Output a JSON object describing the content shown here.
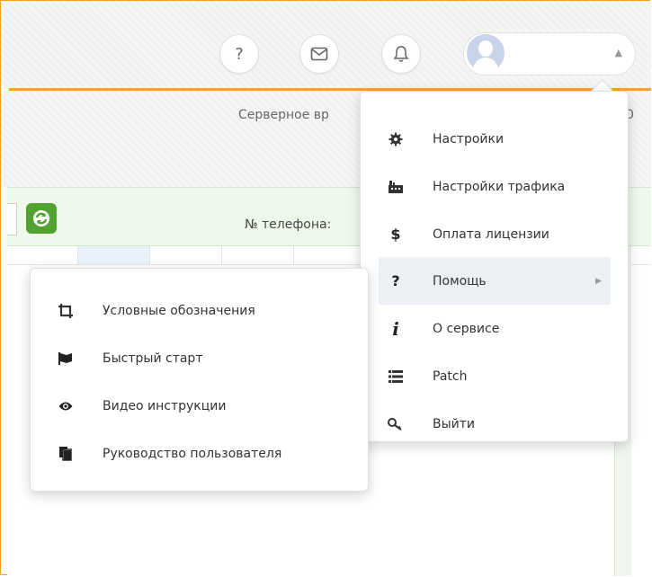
{
  "header": {
    "help_label": "?",
    "user_name": "",
    "user_menu_arrow": "▲"
  },
  "server": {
    "time_label": "Серверное вр",
    "time_tail": "0"
  },
  "filter": {
    "phone_label": "№ телефона:"
  },
  "main_menu": {
    "items": [
      {
        "label": "Настройки",
        "icon": "gear-icon"
      },
      {
        "label": "Настройки трафика",
        "icon": "traffic-icon"
      },
      {
        "label": "Оплата лицензии",
        "icon": "dollar-icon"
      },
      {
        "label": "Помощь",
        "icon": "question-icon",
        "submenu_arrow": "▶"
      },
      {
        "label": "О сервисе",
        "icon": "info-icon"
      },
      {
        "label": "Patch",
        "icon": "list-icon"
      },
      {
        "label": "Выйти",
        "icon": "key-icon"
      }
    ],
    "highlighted_index": 3
  },
  "help_submenu": {
    "items": [
      {
        "label": "Условные обозначения",
        "icon": "crop-icon"
      },
      {
        "label": "Быстрый старт",
        "icon": "flag-icon"
      },
      {
        "label": "Видео инструкции",
        "icon": "eye-icon"
      },
      {
        "label": "Руководство пользователя",
        "icon": "documents-icon"
      }
    ]
  },
  "colors": {
    "accent_orange": "#f0a33c",
    "refresh_green": "#4fa32e",
    "filter_bg": "#eef9ec",
    "highlight_bg": "#eceff4"
  }
}
